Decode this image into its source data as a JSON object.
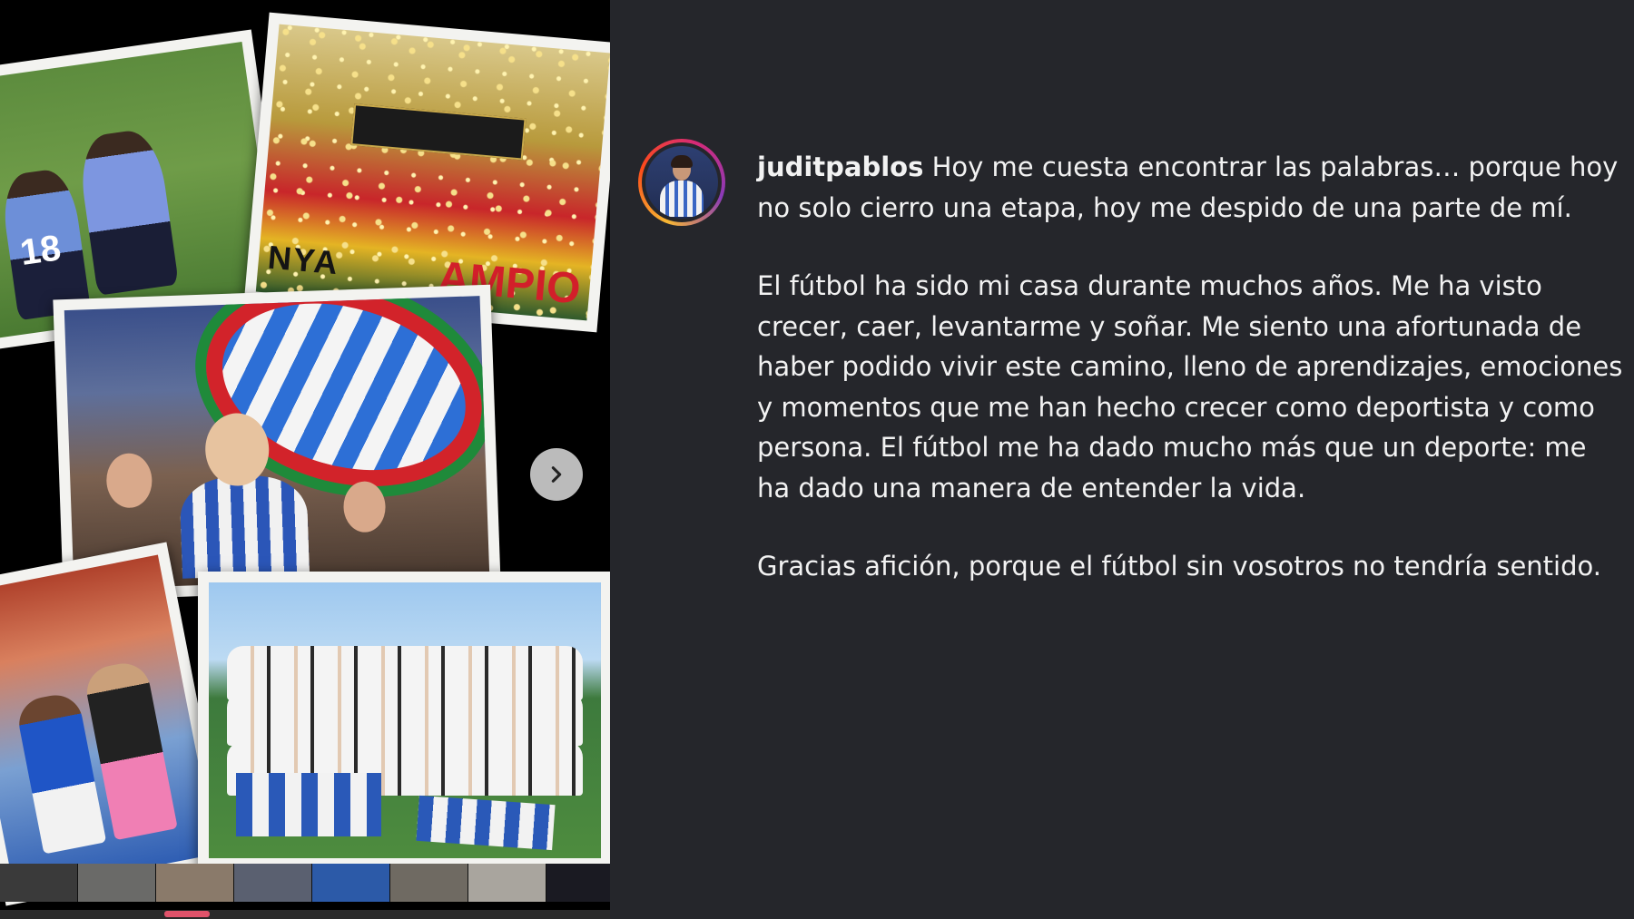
{
  "post": {
    "username": "juditpablos",
    "caption_lines_p1": [
      " Hoy me cuesta encontrar las palabras… porque hoy",
      "no solo cierro una etapa, hoy me despido de una parte de mí."
    ],
    "caption_lines_p2": [
      "El fútbol ha sido mi casa durante muchos años. Me ha visto",
      "crecer, caer, levantarme y soñar. Me siento una afortunada de",
      "haber podido vivir este camino, lleno de aprendizajes, emociones",
      "y momentos que me han hecho crecer como deportista y como",
      "persona. El fútbol me ha dado mucho más que un deporte: me",
      "ha dado una manera de entender la vida."
    ],
    "caption_lines_p3": [
      "Gracias afición, porque el fútbol sin vosotros no tendría sentido."
    ]
  },
  "media": {
    "photo_text": {
      "jersey_number": "18",
      "banner_left": "NYA",
      "banner_right": "AMPIO"
    },
    "next_icon": "chevron-right-icon",
    "carousel_progress": 0.3
  },
  "colors": {
    "panel_bg": "#25262b",
    "media_bg": "#000000",
    "text": "#f2f2f2",
    "progress_accent": "#e0536a"
  }
}
